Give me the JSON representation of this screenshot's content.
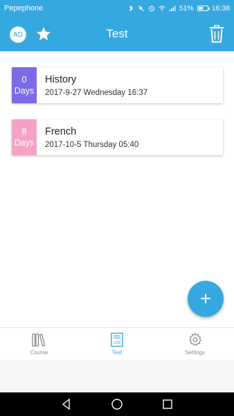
{
  "status_bar": {
    "carrier": "Pepephone",
    "battery": "51%",
    "time": "16:38"
  },
  "app_bar": {
    "avatar_initials": "AD",
    "title": "Test"
  },
  "tests": [
    {
      "days": "0",
      "unit": "Days",
      "subject": "History",
      "date": "2017-9-27 Wednesday 16:37",
      "color": "#7b6be6"
    },
    {
      "days": "8",
      "unit": "Days",
      "subject": "French",
      "date": "2017-10-5 Thursday 05:40",
      "color": "#f4a3c7"
    }
  ],
  "fab": {
    "icon": "plus-icon",
    "symbol": "+"
  },
  "bottom_nav": [
    {
      "label": "Course",
      "icon": "books-icon",
      "active": false
    },
    {
      "label": "Test",
      "icon": "test-paper-icon",
      "active": true
    },
    {
      "label": "Settings",
      "icon": "gear-icon",
      "active": false
    }
  ],
  "colors": {
    "primary": "#35a8e0",
    "inactive": "#8a8a8a"
  }
}
